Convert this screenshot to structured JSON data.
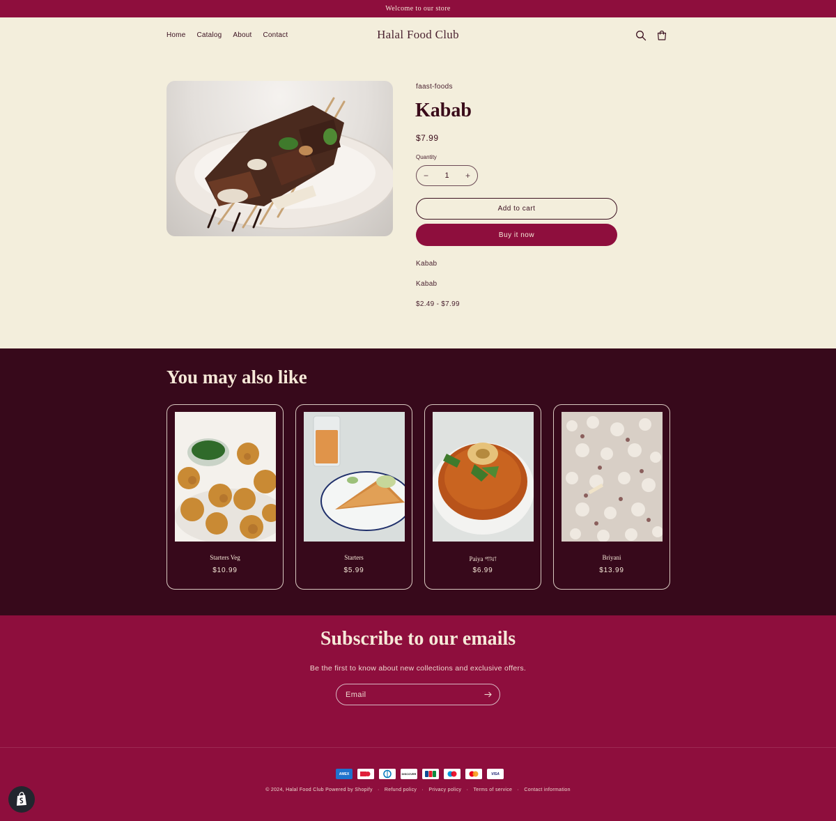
{
  "announcement": "Welcome to our store",
  "header": {
    "nav": [
      "Home",
      "Catalog",
      "About",
      "Contact"
    ],
    "logo": "Halal Food Club"
  },
  "product": {
    "vendor": "faast-foods",
    "title": "Kabab",
    "price": "$7.99",
    "quantity_label": "Quantity",
    "quantity": "1",
    "minus": "−",
    "plus": "+",
    "add_to_cart": "Add to cart",
    "buy_now": "Buy it now",
    "description": [
      "Kabab",
      "Kabab",
      "$2.49 - $7.99"
    ]
  },
  "related": {
    "title": "You may also like",
    "items": [
      {
        "name": "Starters Veg",
        "price": "$10.99"
      },
      {
        "name": "Starters",
        "price": "$5.99"
      },
      {
        "name": "Paiya পায়া",
        "price": "$6.99"
      },
      {
        "name": "Briyani",
        "price": "$13.99"
      }
    ]
  },
  "subscribe": {
    "title": "Subscribe to our emails",
    "text": "Be the first to know about new collections and exclusive offers.",
    "email_placeholder": "Email"
  },
  "footer": {
    "payments": [
      "american-express",
      "diners-club",
      "diners",
      "discover",
      "jcb",
      "maestro",
      "mastercard",
      "visa"
    ],
    "payment_labels": {
      "visa": "VISA",
      "discover": "DISCOVER",
      "jcb": "JCB",
      "amex": "AMEX"
    },
    "copyright": "© 2024, Halal Food Club Powered by Shopify",
    "links": [
      "Refund policy",
      "Privacy policy",
      "Terms of service",
      "Contact information"
    ],
    "separator": "·"
  },
  "colors": {
    "brand": "#8e0e3d",
    "dark": "#37091b",
    "background": "#f3eedc"
  }
}
